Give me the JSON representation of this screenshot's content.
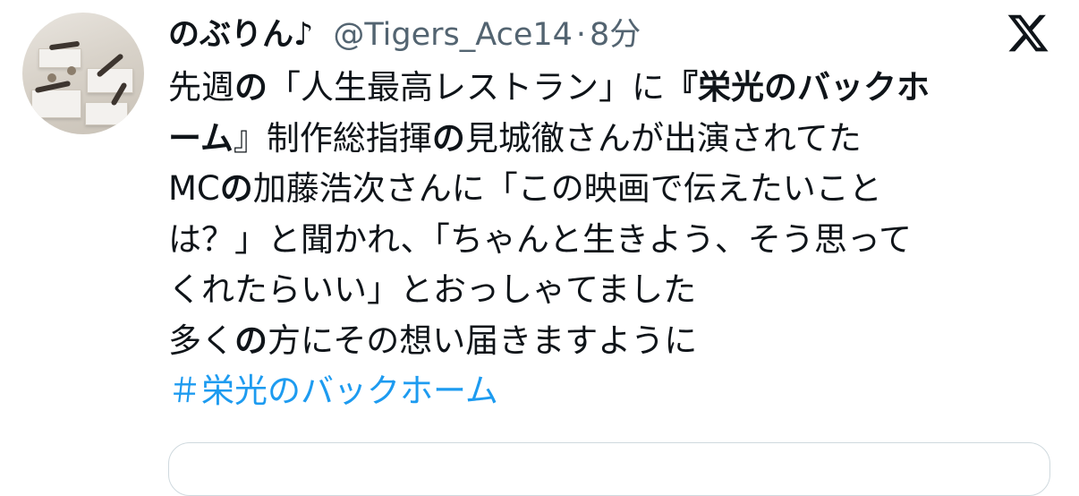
{
  "author": {
    "display_name": "のぶりん♪",
    "handle": "@Tigers_Ace14",
    "separator": "·",
    "time": "8分"
  },
  "logo_icon": "x-logo-icon",
  "body": {
    "l1_a": "先週",
    "l1_b": "の",
    "l1_c": "「人生最高レストラン」に",
    "l1_d": "『栄光のバックホ",
    "l2_a": "ーム",
    "l2_b": "』制作総指揮",
    "l2_c": "の",
    "l2_d": "見城徹さんが出演されてた",
    "l3_a": "MC",
    "l3_b": "の",
    "l3_c": "加藤浩次さんに「この映画で伝えたいこと",
    "l4": "は？」と聞かれ、「ちゃんと生きよう、そう思って",
    "l5": "くれたらいい」とおっしゃてました",
    "l6_a": "多く",
    "l6_b": "の",
    "l6_c": "方にその想い届きますように",
    "hashtag": "＃栄光のバックホーム"
  },
  "colors": {
    "text": "#0f1419",
    "secondary": "#536471",
    "link": "#1d9bf0"
  }
}
